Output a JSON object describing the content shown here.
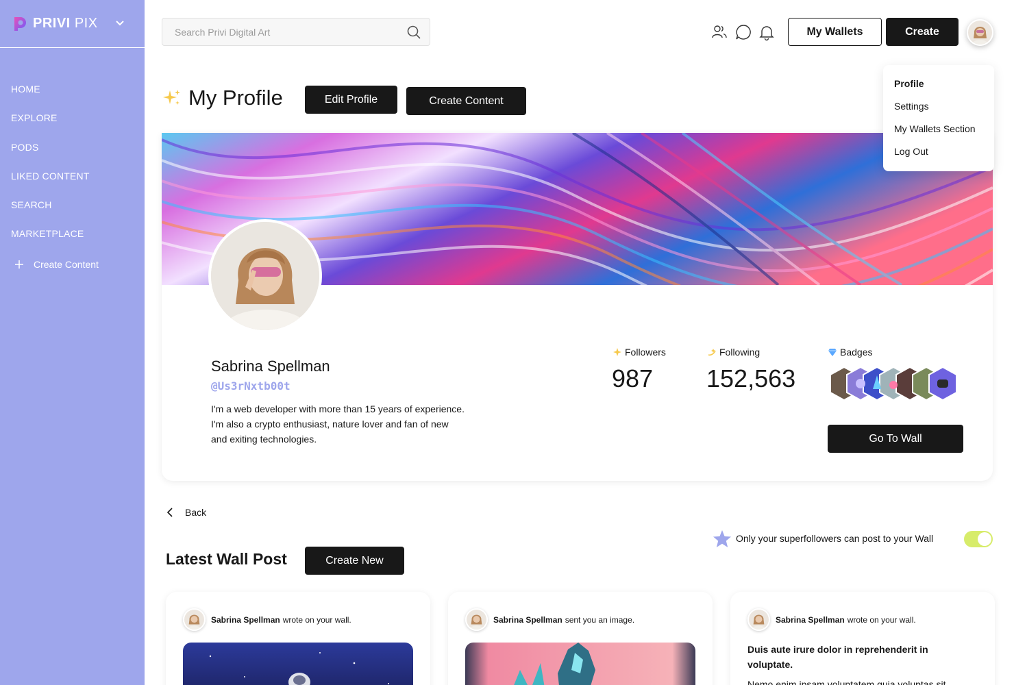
{
  "brand": {
    "bold": "PRIVI",
    "light": "PIX"
  },
  "sidebar": {
    "items": [
      {
        "label": "HOME"
      },
      {
        "label": "EXPLORE"
      },
      {
        "label": "PODS"
      },
      {
        "label": "LIKED CONTENT"
      },
      {
        "label": "SEARCH"
      },
      {
        "label": "MARKETPLACE"
      }
    ],
    "create_label": "Create Content"
  },
  "header": {
    "search_placeholder": "Search Privi Digital Art",
    "wallets_label": "My Wallets",
    "create_label": "Create"
  },
  "dropdown": {
    "items": [
      {
        "label": "Profile"
      },
      {
        "label": "Settings"
      },
      {
        "label": "My Wallets Section"
      },
      {
        "label": "Log Out"
      }
    ]
  },
  "page": {
    "title": "My Profile",
    "edit_profile_label": "Edit Profile",
    "create_content_label": "Create Content"
  },
  "profile": {
    "name": "Sabrina Spellman",
    "handle": "@Us3rNxtb00t",
    "bio": "I'm a web developer with more than 15 years of experience. I'm also a crypto enthusiast, nature lover and fan of new and exiting  technologies.",
    "followers_label": "Followers",
    "followers": "987",
    "following_label": "Following",
    "following": "152,563",
    "badges_label": "Badges",
    "go_to_wall_label": "Go To Wall"
  },
  "wall": {
    "back_label": "Back",
    "title": "Latest Wall Post",
    "create_new_label": "Create New",
    "superfollowers_text": "Only your superfollowers can post to your Wall",
    "superfollowers_enabled": true,
    "posts": [
      {
        "author": "Sabrina Spellman",
        "action": "wrote on your wall."
      },
      {
        "author": "Sabrina Spellman",
        "action": "sent you an image."
      },
      {
        "author": "Sabrina Spellman",
        "action": "wrote on your wall.",
        "title": "Duis aute irure dolor in reprehenderit in voluptate.",
        "body": "Nemo enim ipsam voluptatem quia voluptas sit"
      }
    ]
  },
  "colors": {
    "sidebar": "#9ea6ec",
    "accent": "#9ea6ec",
    "dark": "#181818",
    "toggle_on": "#d7ec6a"
  }
}
